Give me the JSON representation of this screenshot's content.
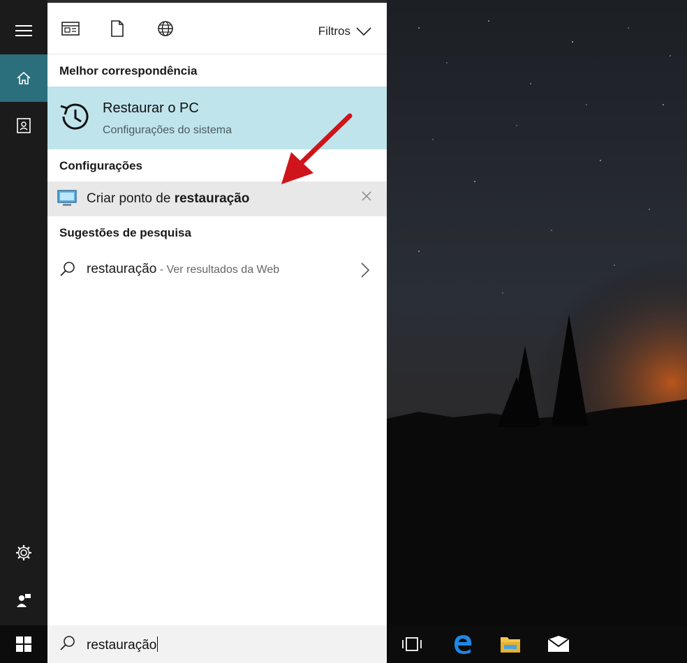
{
  "colors": {
    "accent": "#2b6e7c",
    "best_match_bg": "#bfe4ec",
    "hover_row_bg": "#e8e8e8",
    "rail_bg": "#1b1b1b",
    "arrow": "#d0141b"
  },
  "rail": {
    "items": [
      {
        "icon": "hamburger-icon"
      },
      {
        "icon": "home-icon",
        "active": true
      },
      {
        "icon": "notebook-icon"
      },
      {
        "icon": "settings-gear-icon"
      },
      {
        "icon": "feedback-person-icon"
      }
    ]
  },
  "toolbar": {
    "icons": [
      "apps-icon",
      "document-icon",
      "web-globe-icon"
    ],
    "filters_label": "Filtros"
  },
  "sections": {
    "best_match": "Melhor correspondência",
    "settings": "Configurações",
    "suggestions": "Sugestões de pesquisa"
  },
  "best_match": {
    "icon": "restore-history-icon",
    "title": "Restaurar o PC",
    "subtitle": "Configurações do sistema"
  },
  "setting_item": {
    "icon": "monitor-icon",
    "label_prefix": "Criar ponto de ",
    "label_bold": "restauração"
  },
  "suggestion": {
    "icon": "search-icon",
    "term": "restauração",
    "sub": " - Ver resultados da Web"
  },
  "search": {
    "query": "restauração"
  },
  "taskbar": {
    "icons": [
      "windows-start-icon",
      "task-view-icon",
      "edge-browser-icon",
      "file-explorer-icon",
      "mail-icon"
    ]
  }
}
